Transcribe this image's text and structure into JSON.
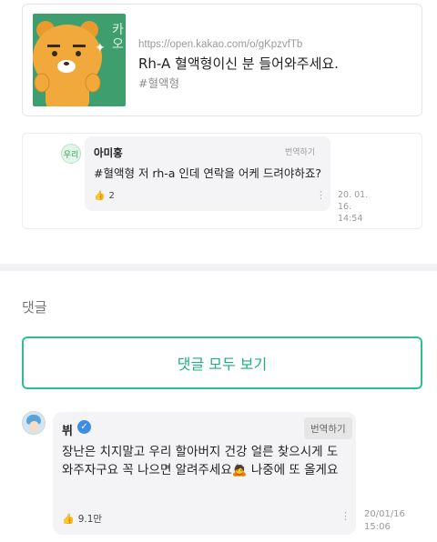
{
  "link_preview": {
    "thumbnail_icon": "ryan-character-icon",
    "thumbnail_mark": "카오",
    "url": "https://open.kakao.com/o/gKpzvfTb",
    "title": "Rh-A 혈액형이신 분 들어와주세요.",
    "tag": "#혈액형"
  },
  "quoted_comment": {
    "avatar_text": "우리",
    "author": "아미홍",
    "translate_label": "번역하기",
    "text": "#혈액형 저 rh-a 인데 연락을 어케 드려야하죠?",
    "likes": "2",
    "more_label": "⋮",
    "time_date": "20. 01. 16.",
    "time_clock": "14:54"
  },
  "comments_section": {
    "title": "댓글",
    "view_all_label": "댓글 모두 보기"
  },
  "comment": {
    "author": "뷔",
    "verified_mark": "✓",
    "translate_label": "번역하기",
    "text": "장난은 치지말고 우리 할아버지 건강 얼른 찾으시게 도와주자구요 꼭 나으면 알려주세요🙇 나중에 또 올게요",
    "likes": "9.1만",
    "more_label": "⋮",
    "time_date": "20/01/16",
    "time_clock": "15:06"
  },
  "colors": {
    "accent": "#2fbf8f",
    "thumbnail_bg": "#3e9e6e",
    "bubble_bg": "#f4f4f6",
    "verified": "#3d8ce6"
  }
}
